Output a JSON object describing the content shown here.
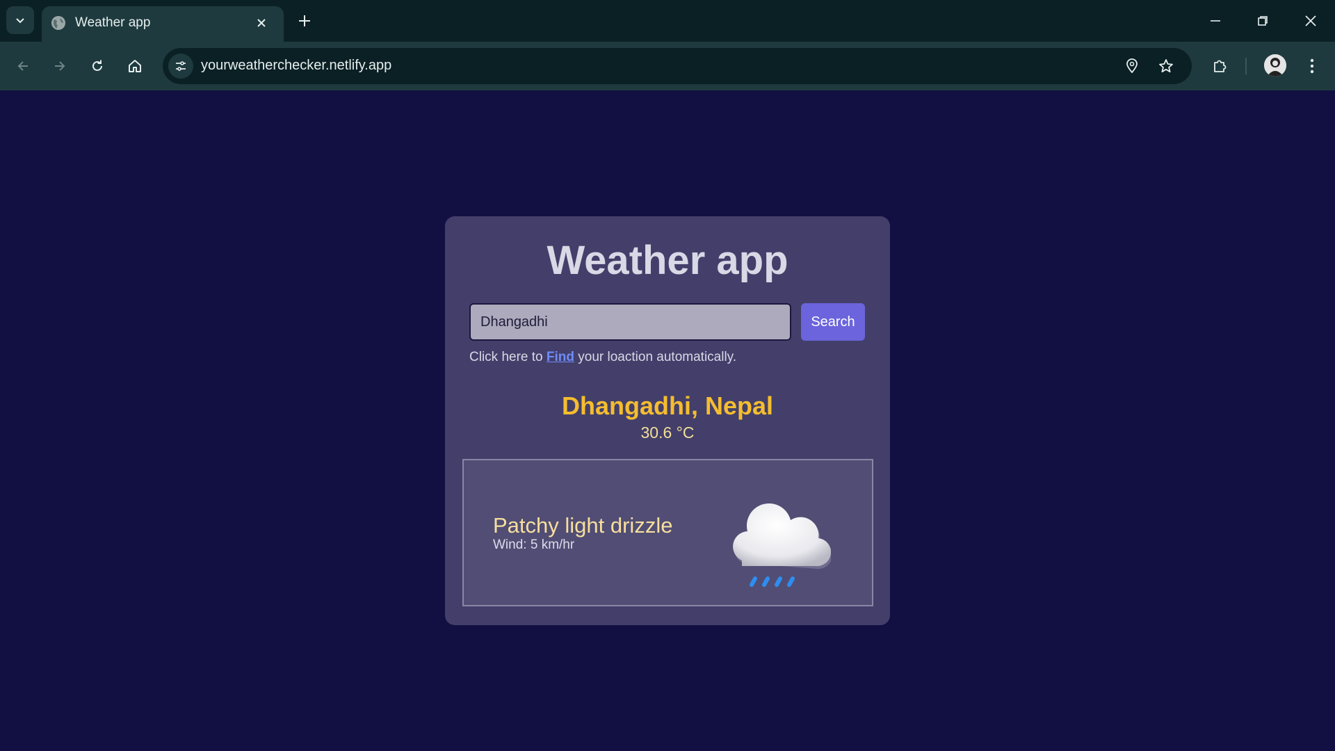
{
  "browser": {
    "tab_title": "Weather app",
    "url": "yourweatherchecker.netlify.app"
  },
  "app": {
    "title": "Weather app",
    "search": {
      "value": "Dhangadhi",
      "button_label": "Search"
    },
    "find_hint": {
      "prefix": "Click here to",
      "link": "Find",
      "suffix": "your loaction automatically."
    },
    "location": "Dhangadhi, Nepal",
    "temperature": "30.6 °C",
    "weather": {
      "condition": "Patchy light drizzle",
      "wind": "Wind: 5 km/hr",
      "icon": "light-rain-cloud-icon"
    }
  },
  "colors": {
    "page_background": "#120f42",
    "card_background": "#433f6a",
    "accent_button": "#6b64dc",
    "location_text": "#f5bd2f",
    "link": "#6f8cf8"
  }
}
